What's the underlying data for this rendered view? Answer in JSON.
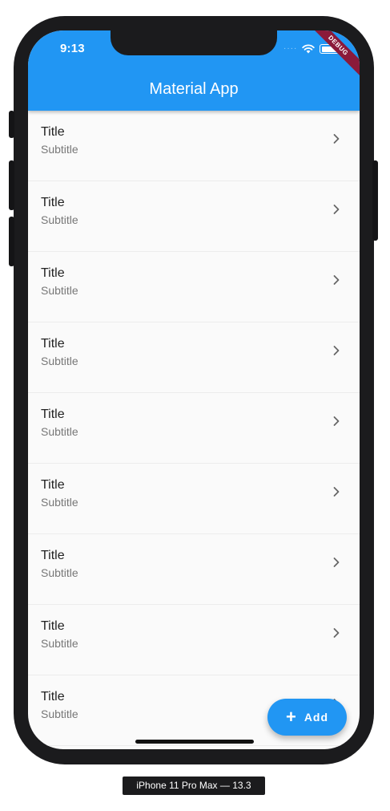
{
  "status_bar": {
    "time": "9:13"
  },
  "debug_banner": "DEBUG",
  "app_bar": {
    "title": "Material App",
    "color": "#2196f3"
  },
  "list": {
    "items": [
      {
        "title": "Title",
        "subtitle": "Subtitle",
        "trailing_icon": "chevron-right-icon"
      },
      {
        "title": "Title",
        "subtitle": "Subtitle",
        "trailing_icon": "chevron-right-icon"
      },
      {
        "title": "Title",
        "subtitle": "Subtitle",
        "trailing_icon": "chevron-right-icon"
      },
      {
        "title": "Title",
        "subtitle": "Subtitle",
        "trailing_icon": "chevron-right-icon"
      },
      {
        "title": "Title",
        "subtitle": "Subtitle",
        "trailing_icon": "chevron-right-icon"
      },
      {
        "title": "Title",
        "subtitle": "Subtitle",
        "trailing_icon": "chevron-right-icon"
      },
      {
        "title": "Title",
        "subtitle": "Subtitle",
        "trailing_icon": "chevron-right-icon"
      },
      {
        "title": "Title",
        "subtitle": "Subtitle",
        "trailing_icon": "chevron-right-icon"
      },
      {
        "title": "Title",
        "subtitle": "Subtitle",
        "trailing_icon": "chevron-right-icon"
      }
    ]
  },
  "fab": {
    "icon": "plus-icon",
    "label": "Add"
  },
  "device_label": "iPhone 11 Pro Max — 13.3"
}
